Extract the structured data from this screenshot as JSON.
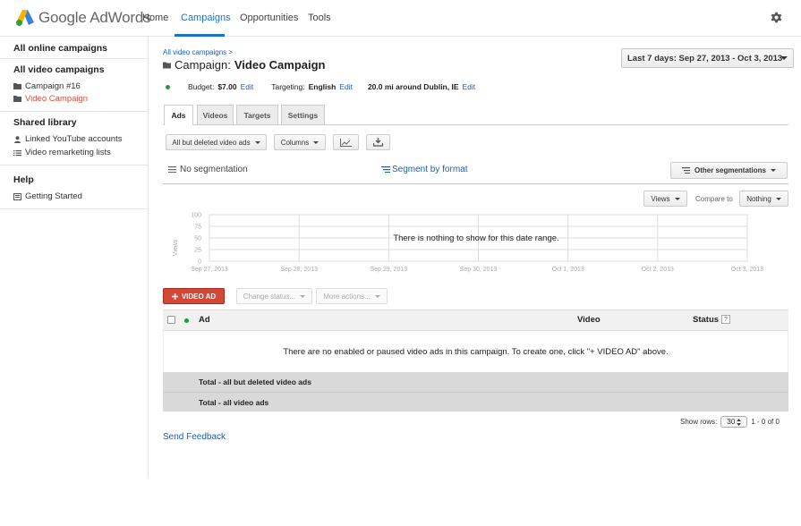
{
  "app": {
    "brand": "Google AdWords",
    "nav": [
      {
        "label": "Home",
        "active": false
      },
      {
        "label": "Campaigns",
        "active": true
      },
      {
        "label": "Opportunities",
        "active": false
      },
      {
        "label": "Tools",
        "active": false
      }
    ],
    "accent_color": "#1a73c8",
    "settings_icon": "gear-icon"
  },
  "sidebar": {
    "all_online": "All online campaigns",
    "all_video": "All video campaigns",
    "campaigns": [
      {
        "label": "Campaign #16",
        "icon": "folder-icon",
        "selected": false
      },
      {
        "label": "Video Campaign",
        "icon": "folder-icon",
        "selected": true
      }
    ],
    "shared_library": "Shared library",
    "shared_items": [
      {
        "label": "Linked YouTube accounts",
        "icon": "person-icon"
      },
      {
        "label": "Video remarketing lists",
        "icon": "list-icon"
      }
    ],
    "help": "Help",
    "help_items": [
      {
        "label": "Getting Started",
        "icon": "book-icon"
      }
    ]
  },
  "main": {
    "breadcrumb": "All video campaigns >",
    "title_prefix": "Campaign:",
    "title_name": "Video Campaign",
    "date_range": "Last 7 days: Sep 27, 2013 - Oct 3, 2013",
    "info": {
      "budget_label": "Budget:",
      "budget_value": "$7.00",
      "edit": "Edit",
      "targeting_label": "Targeting:",
      "targeting_value": "English",
      "location_value": "20.0 mi around Dublin, IE",
      "status_color": "#1e9b3c"
    },
    "tabs": [
      {
        "label": "Ads",
        "active": true
      },
      {
        "label": "Videos",
        "active": false
      },
      {
        "label": "Targets",
        "active": false
      },
      {
        "label": "Settings",
        "active": false
      }
    ],
    "toolbar": {
      "filter": "All but deleted video ads",
      "columns": "Columns"
    },
    "segmentation": {
      "none": "No segmentation",
      "by_format": "Segment by format",
      "other": "Other segmentations"
    },
    "chart_controls": {
      "metric": "Views",
      "compare_label": "Compare to",
      "compare_value": "Nothing"
    },
    "actions": {
      "new_ad": "VIDEO AD",
      "change_status": "Change status...",
      "more_actions": "More actions..."
    },
    "table": {
      "headers": {
        "ad": "Ad",
        "video": "Video",
        "status": "Status"
      },
      "help_mark": "?",
      "empty_message": "There are no enabled or paused video ads in this campaign. To create one, click \"+ VIDEO AD\" above.",
      "totals": [
        "Total - all but deleted video ads",
        "Total - all video ads"
      ]
    },
    "pagination": {
      "show_rows_label": "Show rows:",
      "rows_value": "30",
      "range": "1 - 0 of 0"
    },
    "feedback": "Send Feedback"
  },
  "chart_data": {
    "type": "line",
    "ylabel": "Views",
    "xlabel": "",
    "ylim": [
      0,
      100
    ],
    "yticks": [
      "100",
      "75",
      "50",
      "25",
      "0"
    ],
    "categories": [
      "Sep 27, 2013",
      "Sep 28, 2013",
      "Sep 29, 2013",
      "Sep 30, 2013",
      "Oct 1, 2013",
      "Oct 2, 2013",
      "Oct 3, 2013"
    ],
    "series": [],
    "empty_message": "There is nothing to show for this date range.",
    "grid": true
  }
}
